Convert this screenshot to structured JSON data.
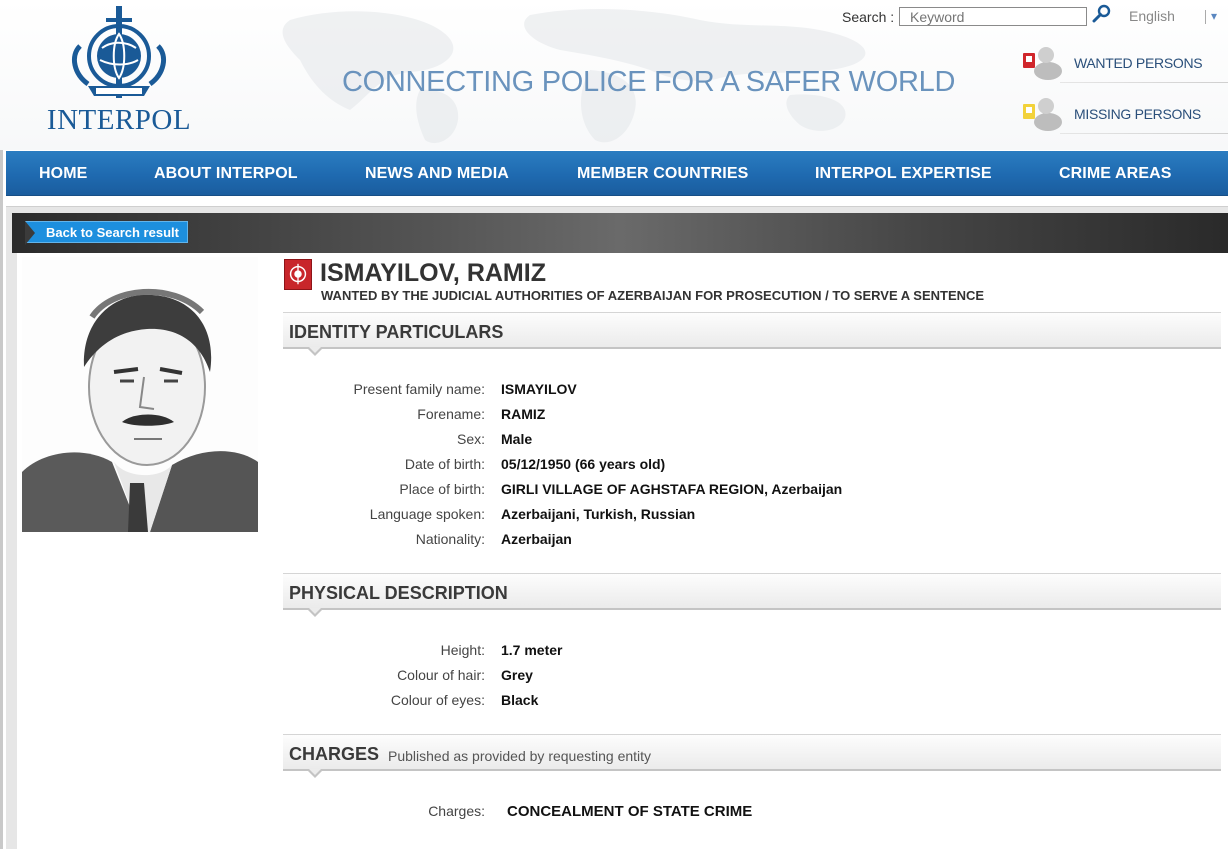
{
  "header": {
    "logo_text": "INTERPOL",
    "slogan": "CONNECTING POLICE FOR A SAFER WORLD",
    "search_label": "Search :",
    "search_placeholder": "Keyword",
    "language": "English",
    "side_links": [
      {
        "label": "WANTED PERSONS",
        "icon": "wanted-person-icon"
      },
      {
        "label": "MISSING PERSONS",
        "icon": "missing-person-icon"
      }
    ]
  },
  "nav": {
    "items": [
      "HOME",
      "ABOUT INTERPOL",
      "NEWS AND MEDIA",
      "MEMBER COUNTRIES",
      "INTERPOL EXPERTISE",
      "CRIME AREAS"
    ]
  },
  "notice": {
    "back_label": "Back to Search result",
    "name": "ISMAYILOV, RAMIZ",
    "subtitle": "WANTED BY THE JUDICIAL AUTHORITIES OF AZERBAIJAN FOR PROSECUTION / TO SERVE A SENTENCE"
  },
  "identity": {
    "title": "IDENTITY PARTICULARS",
    "rows": [
      {
        "label": "Present family name:",
        "value": "ISMAYILOV"
      },
      {
        "label": "Forename:",
        "value": "RAMIZ"
      },
      {
        "label": "Sex:",
        "value": "Male"
      },
      {
        "label": "Date of birth:",
        "value": "05/12/1950 (66 years old)"
      },
      {
        "label": "Place of birth:",
        "value": "GIRLI VILLAGE OF AGHSTAFA REGION, Azerbaijan"
      },
      {
        "label": "Language spoken:",
        "value": "Azerbaijani, Turkish, Russian"
      },
      {
        "label": "Nationality:",
        "value": "Azerbaijan"
      }
    ]
  },
  "physical": {
    "title": "PHYSICAL DESCRIPTION",
    "rows": [
      {
        "label": "Height:",
        "value": "1.7 meter"
      },
      {
        "label": "Colour of hair:",
        "value": "Grey"
      },
      {
        "label": "Colour of eyes:",
        "value": "Black"
      }
    ]
  },
  "charges": {
    "title": "CHARGES",
    "note": "Published as provided by requesting entity",
    "label": "Charges:",
    "value": "CONCEALMENT OF STATE CRIME"
  },
  "colors": {
    "nav_blue": "#1f6ab0",
    "brand_blue": "#1a5a97",
    "back_button": "#1d8fde",
    "notice_red": "#c8262b"
  }
}
